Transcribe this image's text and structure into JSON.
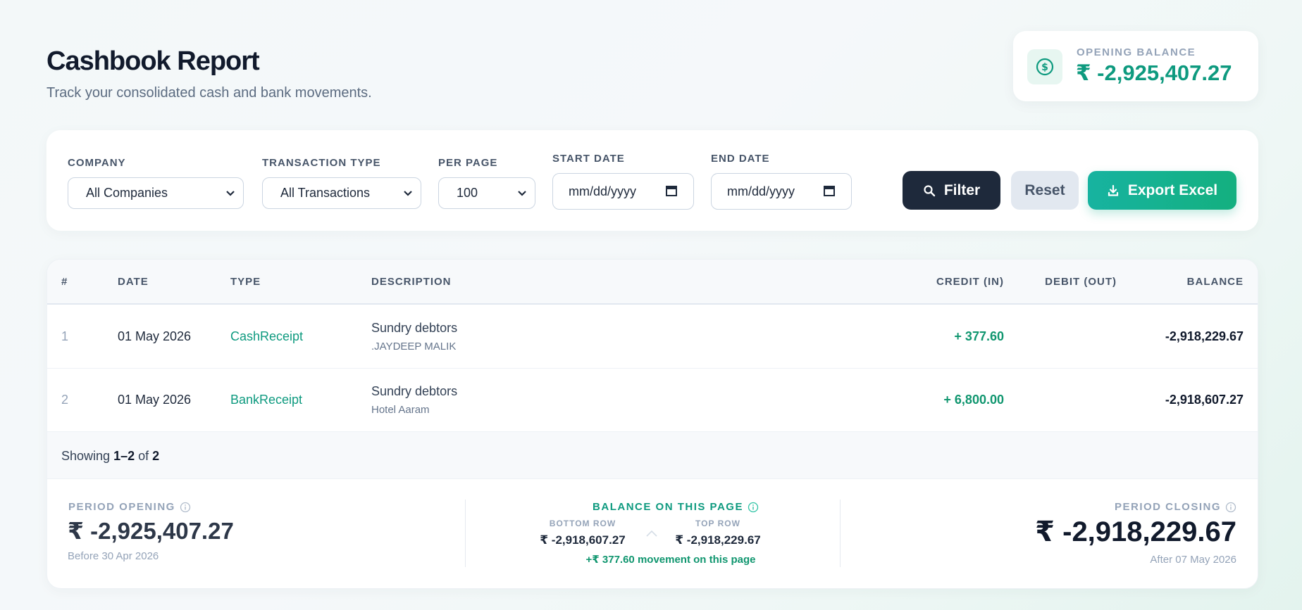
{
  "header": {
    "title": "Cashbook Report",
    "subtitle": "Track your consolidated cash and bank movements."
  },
  "opening_card": {
    "label": "OPENING BALANCE",
    "value": "₹ -2,925,407.27",
    "icon": "dollar-circle-icon"
  },
  "filters": {
    "company": {
      "label": "COMPANY",
      "value": "All Companies"
    },
    "transaction_type": {
      "label": "TRANSACTION TYPE",
      "value": "All Transactions"
    },
    "per_page": {
      "label": "PER PAGE",
      "value": "100"
    },
    "start_date": {
      "label": "START DATE",
      "placeholder": "mm/dd/yyyy"
    },
    "end_date": {
      "label": "END DATE",
      "placeholder": "mm/dd/yyyy"
    },
    "filter_button": "Filter",
    "reset_button": "Reset",
    "export_button": "Export Excel"
  },
  "table": {
    "columns": [
      "#",
      "DATE",
      "TYPE",
      "DESCRIPTION",
      "CREDIT (IN)",
      "DEBIT (OUT)",
      "BALANCE"
    ],
    "rows": [
      {
        "index": "1",
        "date": "01 May 2026",
        "type": "CashReceipt",
        "description": "Sundry debtors",
        "sub": ".JAYDEEP MALIK",
        "credit": "+ 377.60",
        "debit": "",
        "balance": "-2,918,229.67"
      },
      {
        "index": "2",
        "date": "01 May 2026",
        "type": "BankReceipt",
        "description": "Sundry debtors",
        "sub": "Hotel Aaram",
        "credit": "+ 6,800.00",
        "debit": "",
        "balance": "-2,918,607.27"
      }
    ],
    "showing": {
      "prefix": "Showing",
      "range": "1–2",
      "of": "of",
      "total": "2"
    }
  },
  "summary": {
    "period_opening": {
      "label": "PERIOD OPENING",
      "value": "₹ -2,925,407.27",
      "sub": "Before 30 Apr 2026"
    },
    "page_balance": {
      "label": "BALANCE ON THIS PAGE",
      "bottom_label": "BOTTOM ROW",
      "bottom_value": "₹ -2,918,607.27",
      "top_label": "TOP ROW",
      "top_value": "₹ -2,918,229.67",
      "movement": "+₹ 377.60 movement on this page"
    },
    "period_closing": {
      "label": "PERIOD CLOSING",
      "value": "₹ -2,918,229.67",
      "sub": "After 07 May 2026"
    }
  },
  "colors": {
    "accent": "#0e9a7f",
    "dark": "#1e293b",
    "export_gradient_start": "#17b3a0",
    "export_gradient_end": "#14b07f"
  }
}
